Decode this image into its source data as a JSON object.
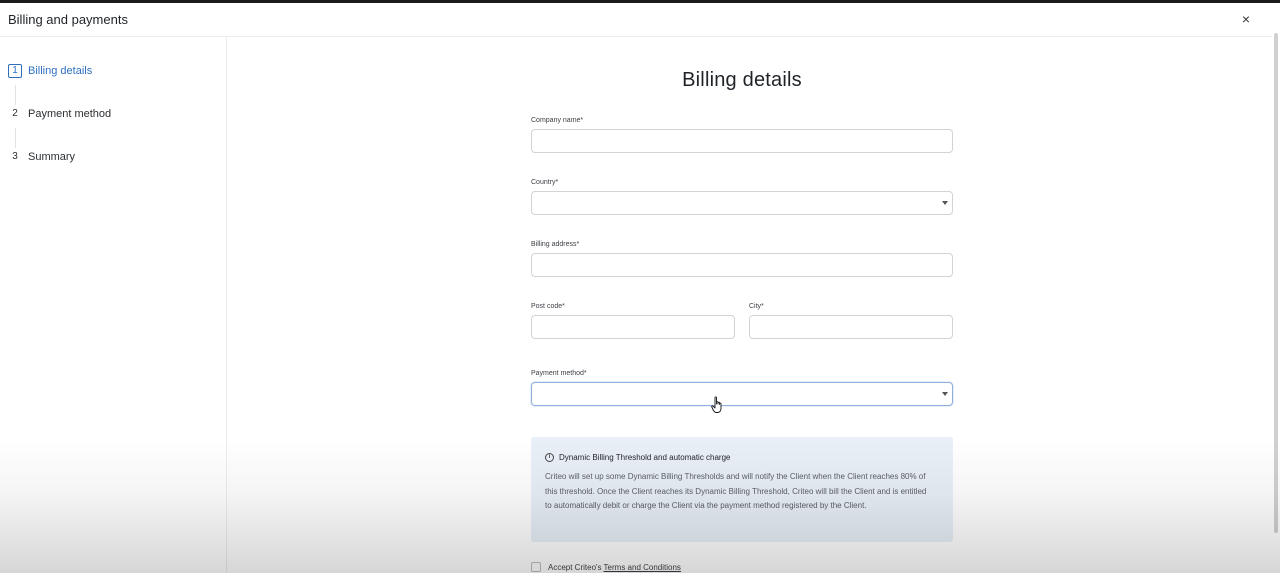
{
  "window": {
    "title": "Billing and payments",
    "close_symbol": "×"
  },
  "sidebar": {
    "steps": [
      {
        "number": "1",
        "label": "Billing details",
        "active": true
      },
      {
        "number": "2",
        "label": "Payment method",
        "active": false
      },
      {
        "number": "3",
        "label": "Summary",
        "active": false
      }
    ]
  },
  "form": {
    "title": "Billing details",
    "company_name": {
      "label": "Company name*",
      "value": ""
    },
    "country": {
      "label": "Country*",
      "value": ""
    },
    "billing_address": {
      "label": "Billing address*",
      "value": ""
    },
    "post_code": {
      "label": "Post code*",
      "value": ""
    },
    "city": {
      "label": "City*",
      "value": ""
    },
    "payment_method": {
      "label": "Payment method*",
      "value": ""
    }
  },
  "info": {
    "title": "Dynamic Billing Threshold and automatic charge",
    "icon_symbol": "i",
    "body": "Criteo will set up some Dynamic Billing Thresholds and will notify the Client when the Client reaches 80% of this threshold. Once the Client reaches its Dynamic Billing Threshold, Criteo will bill the Client and is entitled to automatically debit or charge the Client via the payment method registered by the Client."
  },
  "terms": {
    "prefix": "Accept Criteo's",
    "link": "Terms and Conditions",
    "checked": false
  },
  "colors": {
    "accent": "#2f6fc2",
    "info_background": "#e8eff7",
    "field_border": "#cfd4d9"
  },
  "icons": {
    "close": "close-icon",
    "info": "info-icon",
    "dropdown": "chevron-down-icon",
    "cursor": "hand-pointer-icon"
  }
}
